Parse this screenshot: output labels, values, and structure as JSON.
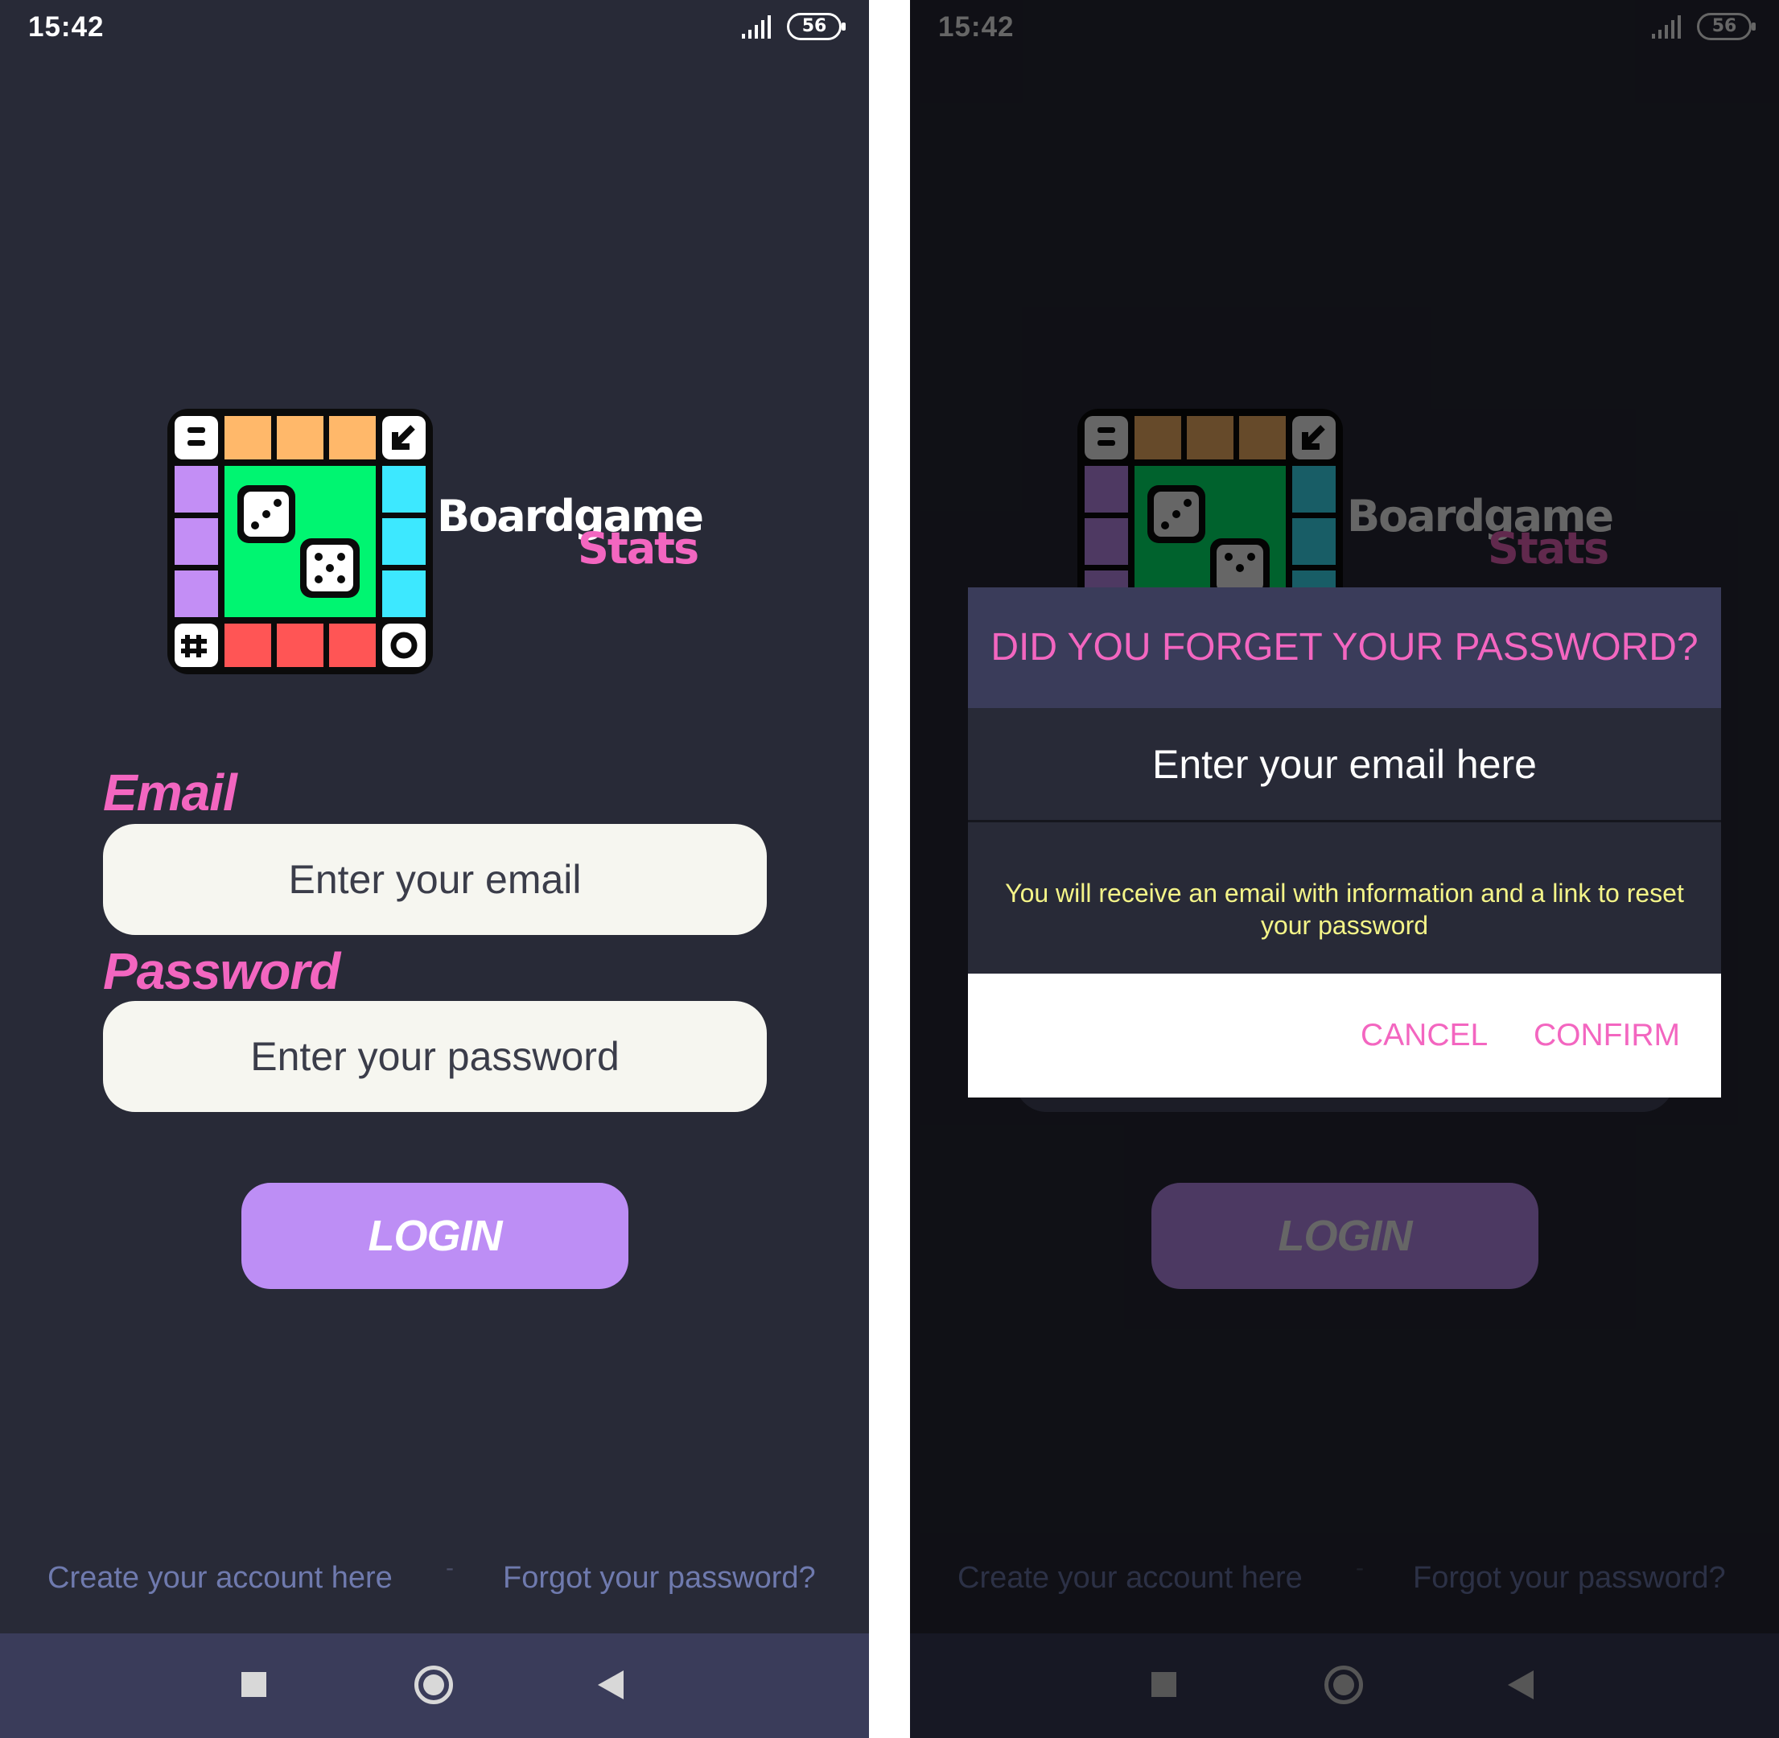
{
  "status_bar": {
    "time": "15:42",
    "battery": "56"
  },
  "app": {
    "logo_word_1": "Boardgame",
    "logo_word_2": "Stats"
  },
  "login": {
    "email_label": "Email",
    "email_placeholder": "Enter your email",
    "password_label": "Password",
    "password_placeholder": "Enter your password",
    "login_button": "LOGIN"
  },
  "footer": {
    "create_account": "Create your account here",
    "separator": "-",
    "forgot_password": "Forgot your password?"
  },
  "dialog": {
    "title": "DID YOU FORGET YOUR PASSWORD?",
    "email_placeholder": "Enter your email here",
    "message": "You will receive an email with information and a link to reset your password",
    "cancel": "CANCEL",
    "confirm": "CONFIRM"
  },
  "colors": {
    "background": "#282a37",
    "accent_pink": "#f366c0",
    "button_purple": "#bd8ef5",
    "link_blue": "#6f7aae",
    "dialog_message_yellow": "#f4f488",
    "nav_bar": "#3a3c5a"
  }
}
